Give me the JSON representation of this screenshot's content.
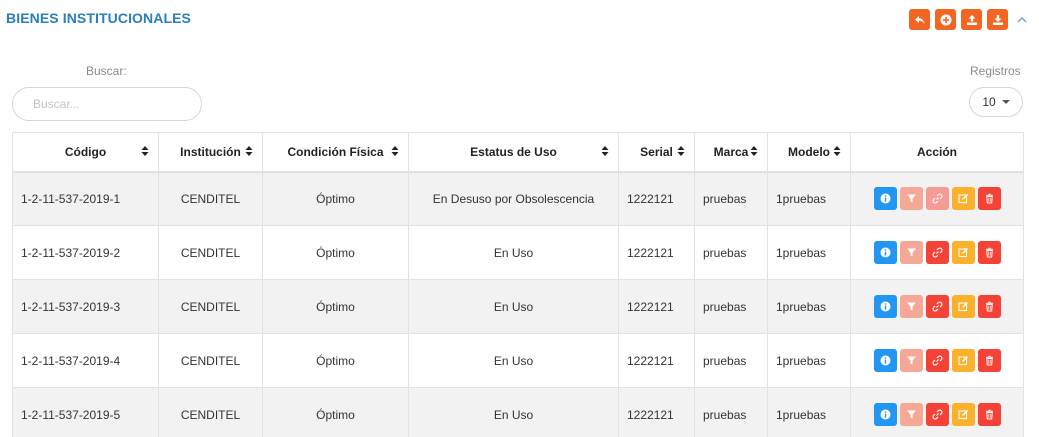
{
  "header": {
    "title": "BIENES INSTITUCIONALES",
    "actions": [
      "undo-icon",
      "add-circle-icon",
      "upload-icon",
      "download-icon"
    ],
    "accent": "#f26522"
  },
  "search": {
    "label": "Buscar:",
    "placeholder": "Buscar...",
    "value": ""
  },
  "records": {
    "label": "Registros",
    "selected": "10"
  },
  "table": {
    "columns": [
      "Código",
      "Institución",
      "Condición Física",
      "Estatus de Uso",
      "Serial",
      "Marca",
      "Modelo",
      "Acción"
    ],
    "rows": [
      {
        "codigo": "1-2-11-537-2019-1",
        "institucion": "CENDITEL",
        "condicion": "Óptimo",
        "estatus": "En Desuso por Obsolescencia",
        "serial": "1222121",
        "marca": "pruebas",
        "modelo": "1pruebas"
      },
      {
        "codigo": "1-2-11-537-2019-2",
        "institucion": "CENDITEL",
        "condicion": "Óptimo",
        "estatus": "En Uso",
        "serial": "1222121",
        "marca": "pruebas",
        "modelo": "1pruebas"
      },
      {
        "codigo": "1-2-11-537-2019-3",
        "institucion": "CENDITEL",
        "condicion": "Óptimo",
        "estatus": "En Uso",
        "serial": "1222121",
        "marca": "pruebas",
        "modelo": "1pruebas"
      },
      {
        "codigo": "1-2-11-537-2019-4",
        "institucion": "CENDITEL",
        "condicion": "Óptimo",
        "estatus": "En Uso",
        "serial": "1222121",
        "marca": "pruebas",
        "modelo": "1pruebas"
      },
      {
        "codigo": "1-2-11-537-2019-5",
        "institucion": "CENDITEL",
        "condicion": "Óptimo",
        "estatus": "En Uso",
        "serial": "1222121",
        "marca": "pruebas",
        "modelo": "1pruebas"
      }
    ],
    "row_actions": [
      "info-icon",
      "filter-icon",
      "link-icon",
      "edit-icon",
      "trash-icon"
    ]
  }
}
